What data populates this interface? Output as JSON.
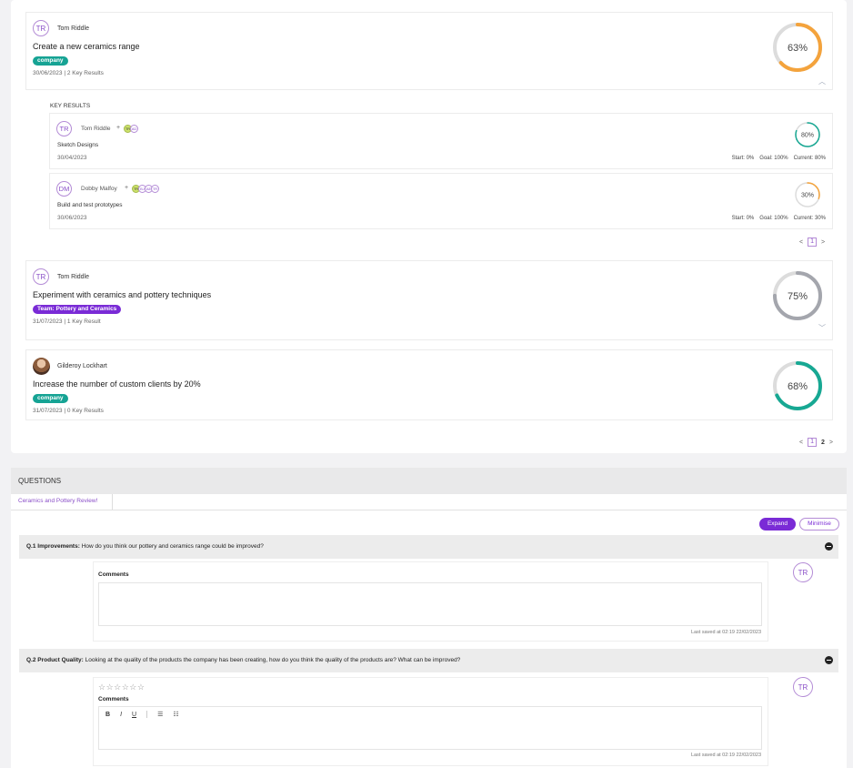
{
  "objectives": [
    {
      "owner_initials": "TR",
      "owner": "Tom Riddle",
      "title": "Create a new ceramics range",
      "badge": "company",
      "meta": "30/06/2023 | 2 Key Results",
      "progress_label": "63%",
      "progress": 63,
      "ring_color": "#f4a33c",
      "expanded": true
    },
    {
      "owner_initials": "TR",
      "owner": "Tom Riddle",
      "title": "Experiment with ceramics and pottery techniques",
      "badge": "Team: Pottery and Ceramics",
      "meta": "31/07/2023 | 1 Key Result",
      "progress_label": "75%",
      "progress": 75,
      "ring_color": "#a4a6ad"
    },
    {
      "owner": "Gilderoy Lockhart",
      "title": "Increase the number of custom clients by 20%",
      "badge": "company",
      "meta": "31/07/2023 | 0 Key Results",
      "progress_label": "68%",
      "progress": 68,
      "ring_color": "#17a893"
    }
  ],
  "key_results": {
    "heading": "KEY RESULTS",
    "items": [
      {
        "owner_initials": "TR",
        "owner": "Tom Riddle",
        "plus": "+",
        "contributors": [
          "TR",
          "AD"
        ],
        "title": "Sketch Designs",
        "date": "30/04/2023",
        "start": "Start: 0%",
        "goal": "Goal: 100%",
        "current": "Current: 80%",
        "progress_label": "80%",
        "progress": 80,
        "ring_color": "#17a893"
      },
      {
        "owner_initials": "DM",
        "owner": "Dobby Malfoy",
        "plus": "+",
        "contributors": [
          "TR",
          "BJ",
          "AE",
          "TR"
        ],
        "title": "Build and test prototypes",
        "date": "30/06/2023",
        "start": "Start: 0%",
        "goal": "Goal: 100%",
        "current": "Current: 30%",
        "progress_label": "30%",
        "progress": 30,
        "ring_color": "#f4a33c"
      }
    ],
    "pager": {
      "prev": "<",
      "current": "1",
      "next": ">"
    }
  },
  "objective_pager": {
    "prev": "<",
    "current": "1",
    "page2": "2",
    "next": ">"
  },
  "questions": {
    "heading": "QUESTIONS",
    "tab": "Ceramics and Pottery Review!",
    "expand": "Expand",
    "minimise": "Minimise",
    "items": [
      {
        "number": "Q.1 Improvements:",
        "text": "How do you think our pottery and ceramics range could be improved?",
        "comments_label": "Comments",
        "saved": "Last saved at 02:19 22/02/2023",
        "avatar": "TR"
      },
      {
        "number": "Q.2 Product Quality:",
        "text": "Looking at the quality of the products the company has been creating, how do you think the quality of the products are? What can be improved?",
        "stars": "☆☆☆☆☆☆",
        "comments_label": "Comments",
        "saved": "Last saved at 02:19 22/02/2023",
        "avatar": "TR"
      }
    ],
    "toolbar": {
      "bold": "B",
      "italic": "I",
      "underline": "U",
      "bullets": "☰",
      "numbers": "☷"
    }
  }
}
